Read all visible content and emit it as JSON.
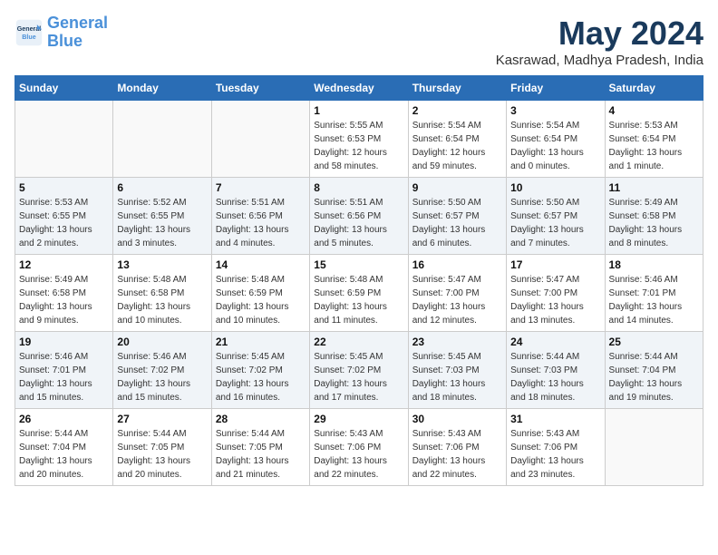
{
  "logo": {
    "line1": "General",
    "line2": "Blue"
  },
  "title": "May 2024",
  "location": "Kasrawad, Madhya Pradesh, India",
  "headers": [
    "Sunday",
    "Monday",
    "Tuesday",
    "Wednesday",
    "Thursday",
    "Friday",
    "Saturday"
  ],
  "weeks": [
    [
      {
        "day": "",
        "info": ""
      },
      {
        "day": "",
        "info": ""
      },
      {
        "day": "",
        "info": ""
      },
      {
        "day": "1",
        "info": "Sunrise: 5:55 AM\nSunset: 6:53 PM\nDaylight: 12 hours\nand 58 minutes."
      },
      {
        "day": "2",
        "info": "Sunrise: 5:54 AM\nSunset: 6:54 PM\nDaylight: 12 hours\nand 59 minutes."
      },
      {
        "day": "3",
        "info": "Sunrise: 5:54 AM\nSunset: 6:54 PM\nDaylight: 13 hours\nand 0 minutes."
      },
      {
        "day": "4",
        "info": "Sunrise: 5:53 AM\nSunset: 6:54 PM\nDaylight: 13 hours\nand 1 minute."
      }
    ],
    [
      {
        "day": "5",
        "info": "Sunrise: 5:53 AM\nSunset: 6:55 PM\nDaylight: 13 hours\nand 2 minutes."
      },
      {
        "day": "6",
        "info": "Sunrise: 5:52 AM\nSunset: 6:55 PM\nDaylight: 13 hours\nand 3 minutes."
      },
      {
        "day": "7",
        "info": "Sunrise: 5:51 AM\nSunset: 6:56 PM\nDaylight: 13 hours\nand 4 minutes."
      },
      {
        "day": "8",
        "info": "Sunrise: 5:51 AM\nSunset: 6:56 PM\nDaylight: 13 hours\nand 5 minutes."
      },
      {
        "day": "9",
        "info": "Sunrise: 5:50 AM\nSunset: 6:57 PM\nDaylight: 13 hours\nand 6 minutes."
      },
      {
        "day": "10",
        "info": "Sunrise: 5:50 AM\nSunset: 6:57 PM\nDaylight: 13 hours\nand 7 minutes."
      },
      {
        "day": "11",
        "info": "Sunrise: 5:49 AM\nSunset: 6:58 PM\nDaylight: 13 hours\nand 8 minutes."
      }
    ],
    [
      {
        "day": "12",
        "info": "Sunrise: 5:49 AM\nSunset: 6:58 PM\nDaylight: 13 hours\nand 9 minutes."
      },
      {
        "day": "13",
        "info": "Sunrise: 5:48 AM\nSunset: 6:58 PM\nDaylight: 13 hours\nand 10 minutes."
      },
      {
        "day": "14",
        "info": "Sunrise: 5:48 AM\nSunset: 6:59 PM\nDaylight: 13 hours\nand 10 minutes."
      },
      {
        "day": "15",
        "info": "Sunrise: 5:48 AM\nSunset: 6:59 PM\nDaylight: 13 hours\nand 11 minutes."
      },
      {
        "day": "16",
        "info": "Sunrise: 5:47 AM\nSunset: 7:00 PM\nDaylight: 13 hours\nand 12 minutes."
      },
      {
        "day": "17",
        "info": "Sunrise: 5:47 AM\nSunset: 7:00 PM\nDaylight: 13 hours\nand 13 minutes."
      },
      {
        "day": "18",
        "info": "Sunrise: 5:46 AM\nSunset: 7:01 PM\nDaylight: 13 hours\nand 14 minutes."
      }
    ],
    [
      {
        "day": "19",
        "info": "Sunrise: 5:46 AM\nSunset: 7:01 PM\nDaylight: 13 hours\nand 15 minutes."
      },
      {
        "day": "20",
        "info": "Sunrise: 5:46 AM\nSunset: 7:02 PM\nDaylight: 13 hours\nand 15 minutes."
      },
      {
        "day": "21",
        "info": "Sunrise: 5:45 AM\nSunset: 7:02 PM\nDaylight: 13 hours\nand 16 minutes."
      },
      {
        "day": "22",
        "info": "Sunrise: 5:45 AM\nSunset: 7:02 PM\nDaylight: 13 hours\nand 17 minutes."
      },
      {
        "day": "23",
        "info": "Sunrise: 5:45 AM\nSunset: 7:03 PM\nDaylight: 13 hours\nand 18 minutes."
      },
      {
        "day": "24",
        "info": "Sunrise: 5:44 AM\nSunset: 7:03 PM\nDaylight: 13 hours\nand 18 minutes."
      },
      {
        "day": "25",
        "info": "Sunrise: 5:44 AM\nSunset: 7:04 PM\nDaylight: 13 hours\nand 19 minutes."
      }
    ],
    [
      {
        "day": "26",
        "info": "Sunrise: 5:44 AM\nSunset: 7:04 PM\nDaylight: 13 hours\nand 20 minutes."
      },
      {
        "day": "27",
        "info": "Sunrise: 5:44 AM\nSunset: 7:05 PM\nDaylight: 13 hours\nand 20 minutes."
      },
      {
        "day": "28",
        "info": "Sunrise: 5:44 AM\nSunset: 7:05 PM\nDaylight: 13 hours\nand 21 minutes."
      },
      {
        "day": "29",
        "info": "Sunrise: 5:43 AM\nSunset: 7:06 PM\nDaylight: 13 hours\nand 22 minutes."
      },
      {
        "day": "30",
        "info": "Sunrise: 5:43 AM\nSunset: 7:06 PM\nDaylight: 13 hours\nand 22 minutes."
      },
      {
        "day": "31",
        "info": "Sunrise: 5:43 AM\nSunset: 7:06 PM\nDaylight: 13 hours\nand 23 minutes."
      },
      {
        "day": "",
        "info": ""
      }
    ]
  ]
}
